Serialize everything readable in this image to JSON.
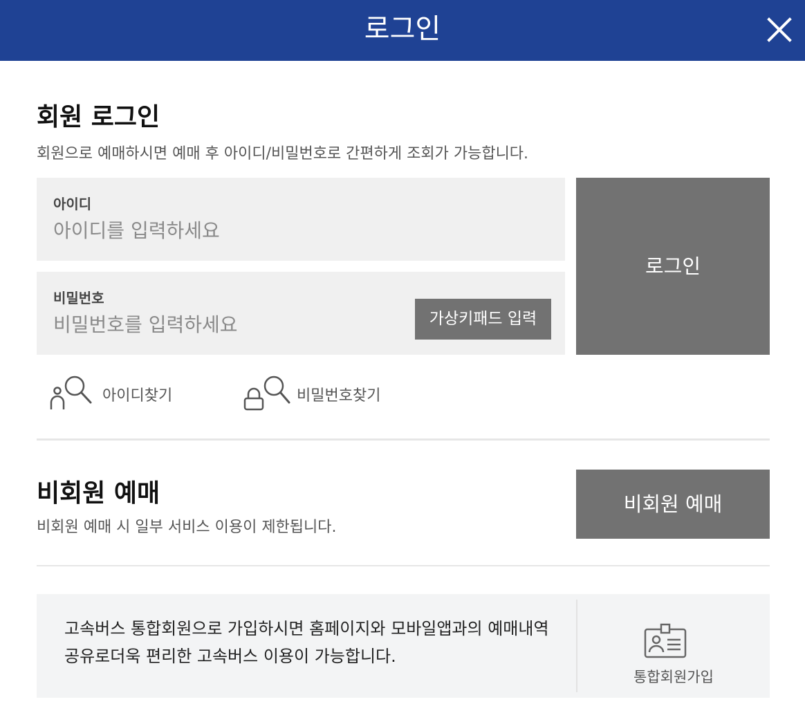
{
  "header": {
    "title": "로그인"
  },
  "member_login": {
    "title": "회원 로그인",
    "description": "회원으로 예매하시면 예매 후 아이디/비밀번호로 간편하게 조회가 가능합니다.",
    "id_field": {
      "label": "아이디",
      "placeholder": "아이디를 입력하세요"
    },
    "password_field": {
      "label": "비밀번호",
      "placeholder": "비밀번호를 입력하세요",
      "keypad_label": "가상키패드 입력"
    },
    "login_button": "로그인",
    "find_id": "아이디찾기",
    "find_password": "비밀번호찾기"
  },
  "guest": {
    "title": "비회원 예매",
    "description": "비회원 예매 시 일부 서비스 이용이 제한됩니다.",
    "button": "비회원 예매"
  },
  "promo": {
    "text": "고속버스 통합회원으로 가입하시면 홈페이지와 모바일앱과의 예매내역 공유로더욱 편리한 고속버스 이용이 가능합니다.",
    "join_label": "통합회원가입",
    "join_icon": "id-card-icon"
  },
  "colors": {
    "header_bg": "#1f4294",
    "button_bg": "#727272",
    "field_bg": "#f0f0f0"
  }
}
